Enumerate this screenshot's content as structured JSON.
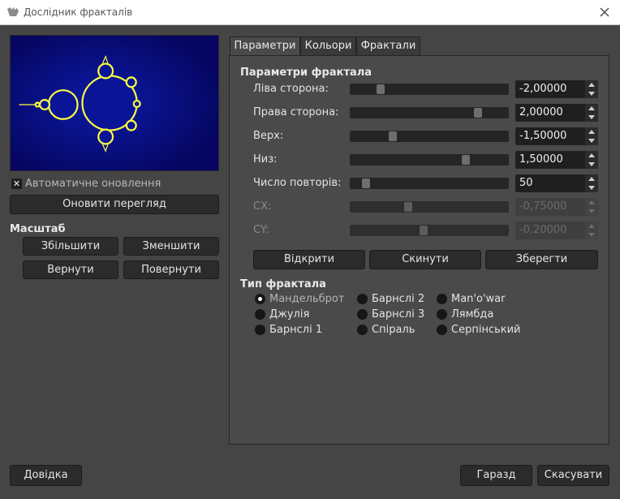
{
  "window": {
    "title": "Дослідник фракталів",
    "icon": "gimp-icon"
  },
  "preview": {
    "auto_update_label": "Автоматичне оновлення",
    "auto_update_checked": true,
    "refresh_label": "Оновити перегляд"
  },
  "zoom": {
    "title": "Масштаб",
    "zoom_in": "Збільшити",
    "zoom_out": "Зменшити",
    "undo": "Вернути",
    "redo": "Повернути"
  },
  "tabs": [
    {
      "label": "Параметри",
      "active": true
    },
    {
      "label": "Кольори",
      "active": false
    },
    {
      "label": "Фрактали",
      "active": false
    }
  ],
  "params": {
    "title": "Параметри фрактала",
    "rows": [
      {
        "label": "Ліва сторона:",
        "value": "-2,00000",
        "level": 0.18,
        "enabled": true
      },
      {
        "label": "Права сторона:",
        "value": "2,00000",
        "level": 0.82,
        "enabled": true
      },
      {
        "label": "Верх:",
        "value": "-1,50000",
        "level": 0.26,
        "enabled": true
      },
      {
        "label": "Низ:",
        "value": "1,50000",
        "level": 0.74,
        "enabled": true
      },
      {
        "label": "Число повторів:",
        "value": "50",
        "level": 0.08,
        "enabled": true
      },
      {
        "label": "CX:",
        "value": "-0,75000",
        "level": 0.36,
        "enabled": false
      },
      {
        "label": "CY:",
        "value": "-0,20000",
        "level": 0.46,
        "enabled": false
      }
    ],
    "open": "Відкрити",
    "reset": "Скинути",
    "save": "Зберегти"
  },
  "fractal_type": {
    "title": "Тип фрактала",
    "options": [
      {
        "label": "Мандельброт",
        "selected": true
      },
      {
        "label": "Джулія",
        "selected": false
      },
      {
        "label": "Барнслі 1",
        "selected": false
      },
      {
        "label": "Барнслі 2",
        "selected": false
      },
      {
        "label": "Барнслі 3",
        "selected": false
      },
      {
        "label": "Спіраль",
        "selected": false
      },
      {
        "label": "Man'o'war",
        "selected": false
      },
      {
        "label": "Лямбда",
        "selected": false
      },
      {
        "label": "Серпінський",
        "selected": false
      }
    ]
  },
  "footer": {
    "help": "Довідка",
    "ok": "Гаразд",
    "cancel": "Скасувати"
  },
  "colors": {
    "preview_bg": "#0a0a78",
    "fractal_body": "#0a1496",
    "fractal_edge": "#ffff40"
  }
}
